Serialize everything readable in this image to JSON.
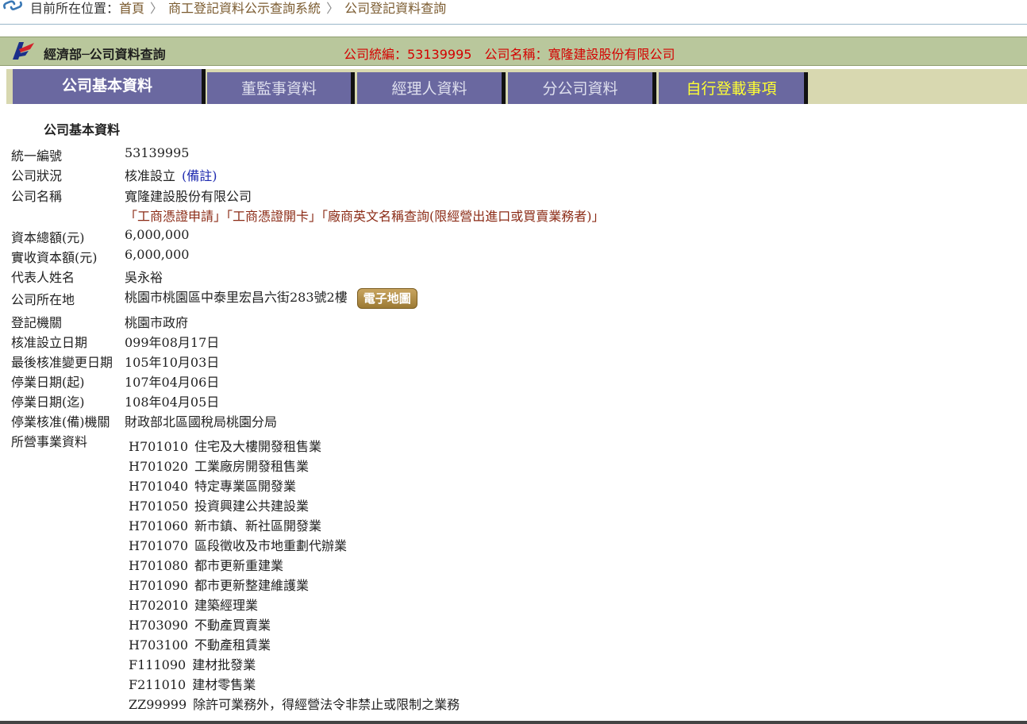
{
  "breadcrumb": {
    "prefix": "目前所在位置：",
    "items": [
      "首頁",
      "商工登記資料公示查詢系統",
      "公司登記資料查詢"
    ],
    "separator": "〉"
  },
  "header": {
    "title": "經濟部─公司資料查詢",
    "info": "公司統編：53139995　公司名稱：寬隆建設股份有限公司"
  },
  "tabs": [
    {
      "label": "公司基本資料",
      "active": true
    },
    {
      "label": "董監事資料"
    },
    {
      "label": "經理人資料"
    },
    {
      "label": "分公司資料"
    },
    {
      "label": "自行登載事項"
    }
  ],
  "section_title": "公司基本資料",
  "fields": {
    "id": {
      "label": "統一編號",
      "value": "53139995"
    },
    "status": {
      "label": "公司狀況",
      "value": "核准設立",
      "note": "(備註)"
    },
    "name": {
      "label": "公司名稱",
      "value": "寬隆建設股份有限公司"
    },
    "capital": {
      "label": "資本總額(元)",
      "value": "6,000,000"
    },
    "paid_capital": {
      "label": "實收資本額(元)",
      "value": "6,000,000"
    },
    "rep": {
      "label": "代表人姓名",
      "value": "吳永裕"
    },
    "address": {
      "label": "公司所在地",
      "value": "桃園市桃園區中泰里宏昌六街283號2樓",
      "map_button": "電子地圖"
    },
    "authority": {
      "label": "登記機關",
      "value": "桃園市政府"
    },
    "setup_date": {
      "label": "核准設立日期",
      "value": "099年08月17日"
    },
    "last_change": {
      "label": "最後核准變更日期",
      "value": "105年10月03日"
    },
    "suspend_start": {
      "label": "停業日期(起)",
      "value": "107年04月06日"
    },
    "suspend_end": {
      "label": "停業日期(迄)",
      "value": "108年04月05日"
    },
    "suspend_auth": {
      "label": "停業核准(備)機關",
      "value": "財政部北區國稅局桃園分局"
    },
    "business_label": "所營事業資料"
  },
  "links": [
    "「工商憑證申請」",
    "「工商憑證開卡」",
    "「廠商英文名稱查詢(限經營出進口或買賣業務者)」"
  ],
  "business": [
    {
      "code": "H701010",
      "desc": "住宅及大樓開發租售業"
    },
    {
      "code": "H701020",
      "desc": "工業廠房開發租售業"
    },
    {
      "code": "H701040",
      "desc": "特定專業區開發業"
    },
    {
      "code": "H701050",
      "desc": "投資興建公共建設業"
    },
    {
      "code": "H701060",
      "desc": "新市鎮、新社區開發業"
    },
    {
      "code": "H701070",
      "desc": "區段徵收及市地重劃代辦業"
    },
    {
      "code": "H701080",
      "desc": "都市更新重建業"
    },
    {
      "code": "H701090",
      "desc": "都市更新整建維護業"
    },
    {
      "code": "H702010",
      "desc": "建築經理業"
    },
    {
      "code": "H703090",
      "desc": "不動產買賣業"
    },
    {
      "code": "H703100",
      "desc": "不動產租賃業"
    },
    {
      "code": "F111090",
      "desc": "建材批發業"
    },
    {
      "code": "F211010",
      "desc": "建材零售業"
    },
    {
      "code": "ZZ99999",
      "desc": "除許可業務外，得經營法令非禁止或限制之業務"
    }
  ]
}
